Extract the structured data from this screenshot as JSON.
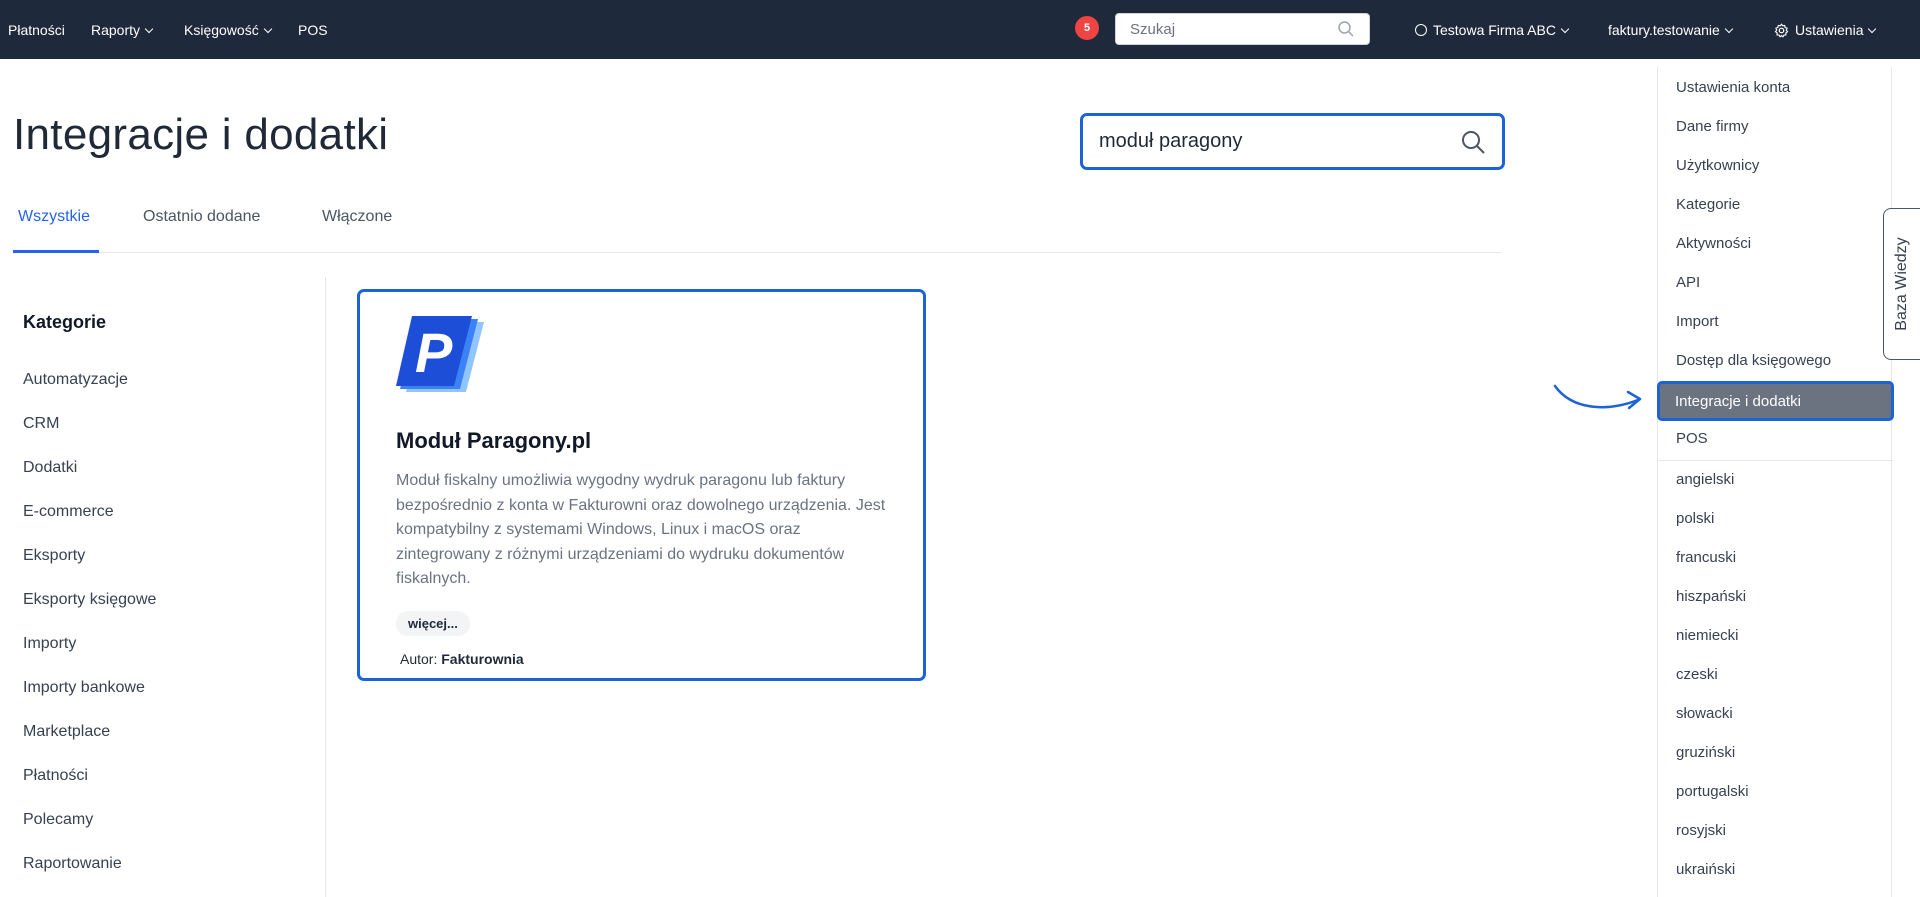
{
  "topbar": {
    "nav": [
      {
        "label": "Płatności"
      },
      {
        "label": "Raporty"
      },
      {
        "label": "Księgowość"
      },
      {
        "label": "POS"
      }
    ],
    "notifications_count": "5",
    "search_placeholder": "Szukaj",
    "company": "Testowa Firma ABC",
    "account": "faktury.testowanie",
    "settings_label": "Ustawienia"
  },
  "page": {
    "title": "Integracje i dodatki",
    "search_value": "moduł paragony"
  },
  "tabs": [
    {
      "label": "Wszystkie",
      "active": true
    },
    {
      "label": "Ostatnio dodane",
      "active": false
    },
    {
      "label": "Włączone",
      "active": false
    }
  ],
  "categories": {
    "title": "Kategorie",
    "items": [
      "Automatyzacje",
      "CRM",
      "Dodatki",
      "E-commerce",
      "Eksporty",
      "Eksporty księgowe",
      "Importy",
      "Importy bankowe",
      "Marketplace",
      "Płatności",
      "Polecamy",
      "Raportowanie"
    ]
  },
  "card": {
    "logo_icon": "paragony-p-logo",
    "title": "Moduł Paragony.pl",
    "description": "Moduł fiskalny umożliwia wygodny wydruk paragonu lub faktury bezpośrednio z konta w Fakturowni oraz dowolnego urządzenia. Jest kompatybilny z systemami Windows, Linux i macOS oraz zintegrowany z różnymi urządzeniami do wydruku dokumentów fiskalnych.",
    "more_label": "więcej...",
    "author_prefix": "Autor: ",
    "author_name": "Fakturownia"
  },
  "settings_menu": {
    "items": [
      "Ustawienia konta",
      "Dane firmy",
      "Użytkownicy",
      "Kategorie",
      "Aktywności",
      "API",
      "Import",
      "Dostęp dla księgowego",
      "Integracje i dodatki",
      "POS"
    ],
    "highlighted": "Integracje i dodatki",
    "languages": [
      "angielski",
      "polski",
      "francuski",
      "hiszpański",
      "niemiecki",
      "czeski",
      "słowacki",
      "gruziński",
      "portugalski",
      "rosyjski",
      "ukraiński"
    ]
  },
  "knowledge_base_tab": "Baza Wiedzy",
  "colors": {
    "topbar": "#1e293b",
    "accent": "#2563eb",
    "highlight_border": "#1d63d8",
    "badge": "#ef4444",
    "menu_highlight": "#6b7280"
  }
}
